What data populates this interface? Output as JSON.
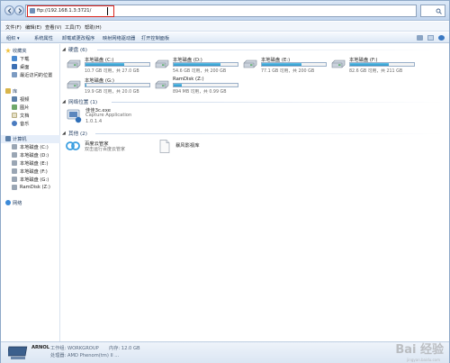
{
  "address_bar": {
    "url": "ftp://192.168.1.3:3721/",
    "search_placeholder": ""
  },
  "menu": [
    "文件(F)",
    "编辑(E)",
    "查看(V)",
    "工具(T)",
    "帮助(H)"
  ],
  "toolbar": [
    "组织 ▾",
    "系统属性",
    "卸载或更改程序",
    "映射网络驱动器",
    "打开控制面板"
  ],
  "sidebar": {
    "favorites_header": "收藏夹",
    "favorites": [
      "下载",
      "桌面",
      "最近访问的位置"
    ],
    "library_header": "库",
    "library": [
      "视频",
      "图片",
      "文档",
      "音乐"
    ],
    "computer_header": "计算机",
    "computer": [
      "本地磁盘 (C:)",
      "本地磁盘 (D:)",
      "本地磁盘 (E:)",
      "本地磁盘 (F:)",
      "本地磁盘 (G:)",
      "RamDisk (Z:)"
    ],
    "network": "网络"
  },
  "groups": {
    "hard_disks": "硬盘 (6)",
    "network_locations": "网络位置 (1)",
    "other": "其他 (2)"
  },
  "drives": [
    {
      "name": "本地磁盘 (C:)",
      "size": "10.7 GB 可用，共 27.0 GB",
      "used": 0.6
    },
    {
      "name": "本地磁盘 (D:)",
      "size": "54.6 GB 可用，共 200 GB",
      "used": 0.73
    },
    {
      "name": "本地磁盘 (E:)",
      "size": "77.1 GB 可用，共 200 GB",
      "used": 0.62
    },
    {
      "name": "本地磁盘 (F:)",
      "size": "82.6 GB 可用，共 211 GB",
      "used": 0.61
    },
    {
      "name": "本地磁盘 (G:)",
      "size": "19.9 GB 可用，共 20.0 GB",
      "used": 0.01
    },
    {
      "name": "RamDisk (Z:)",
      "size": "894 MB 可用，共 0.99 GB",
      "used": 0.12
    }
  ],
  "network_location": {
    "name": "佳佳3c.exe",
    "description": "Capture Application",
    "version": "1.0.1.4"
  },
  "other_items": [
    {
      "name": "百度云管家",
      "description": "双击运行百度云管家"
    },
    {
      "name": "暴风影视库"
    }
  ],
  "details": {
    "computer_name": "ARNOL",
    "workgroup": "工作组: WORKGROUP",
    "memory": "内存: 12.0 GB",
    "processor": "处理器: AMD Phenom(tm) II ..."
  },
  "watermark": "Bai 经验",
  "watermark_sub": "jingyan.baidu.com",
  "colors": {
    "accent": "#2a95c8",
    "highlight_box": "#d9241c",
    "header_text": "#1e3a5f"
  }
}
